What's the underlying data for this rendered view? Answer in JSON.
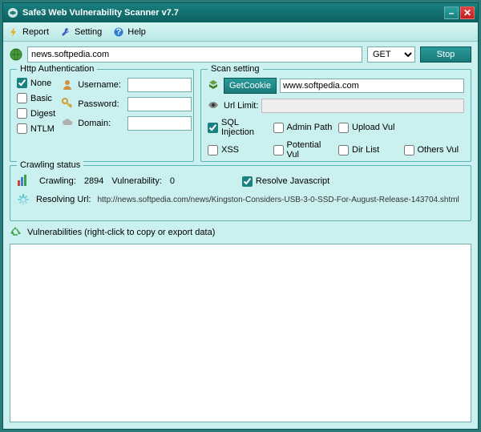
{
  "titlebar": {
    "title": "Safe3 Web Vulnerability Scanner v7.7"
  },
  "toolbar": {
    "report": "Report",
    "setting": "Setting",
    "help": "Help"
  },
  "urlbar": {
    "url": "news.softpedia.com",
    "method": "GET",
    "stop": "Stop"
  },
  "http_auth": {
    "legend": "Http Authentication",
    "none": "None",
    "basic": "Basic",
    "digest": "Digest",
    "ntlm": "NTLM",
    "username_label": "Username:",
    "password_label": "Password:",
    "domain_label": "Domain:",
    "username": "",
    "password": "",
    "domain": ""
  },
  "scan": {
    "legend": "Scan setting",
    "getcookie": "GetCookie",
    "cookie_value": "www.softpedia.com",
    "urllimit_label": "Url Limit:",
    "urllimit_placeholder": "",
    "sql": "SQL Injection",
    "admin": "Admin Path",
    "upload": "Upload Vul",
    "xss": "XSS",
    "potential": "Potential Vul",
    "dirlist": "Dir List",
    "others": "Others Vul"
  },
  "crawl": {
    "legend": "Crawling status",
    "crawling_label": "Crawling:",
    "crawling_value": "2894",
    "vuln_label": "Vulnerability:",
    "vuln_value": "0",
    "resolve_js": "Resolve Javascript",
    "resolving_label": "Resolving Url:",
    "resolving_url": "http://news.softpedia.com/news/Kingston-Considers-USB-3-0-SSD-For-August-Release-143704.shtml"
  },
  "vuln_section": {
    "header": "Vulnerabilities (right-click to copy or export data)"
  }
}
